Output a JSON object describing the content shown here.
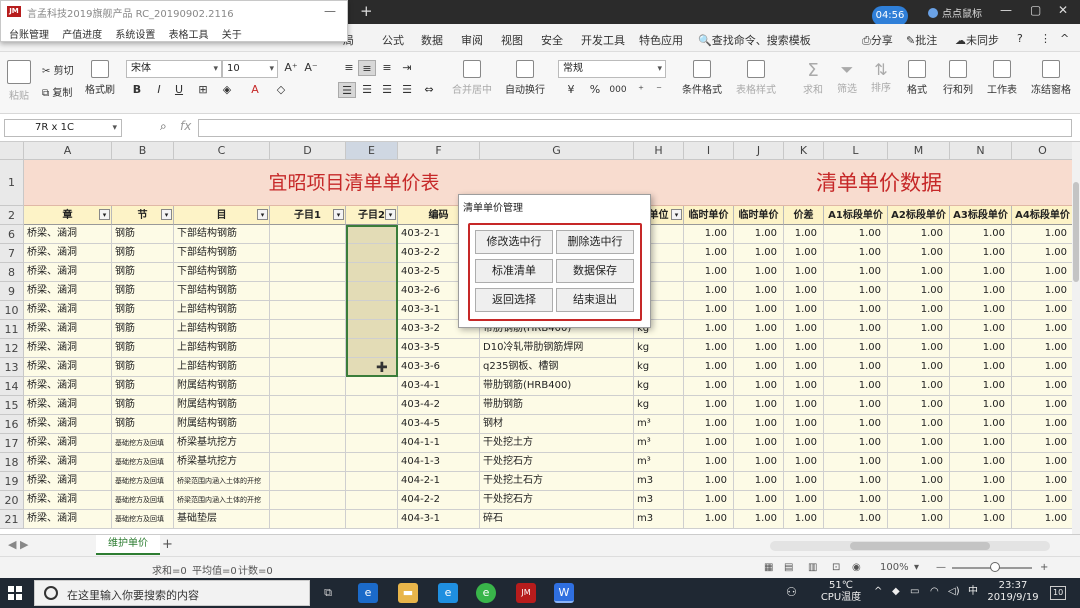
{
  "window": {
    "time_badge": "04:56",
    "mouse_label": "点点鼠标",
    "new_tab": "+",
    "win_min": "—",
    "win_max": "▢",
    "win_close": "✕"
  },
  "popup": {
    "title": "言孟科技2019旗舰产品 RC_20190902.2116",
    "logo": "JM",
    "minimize": "—",
    "menu": [
      "台账管理",
      "产值进度",
      "系统设置",
      "表格工具",
      "关于"
    ]
  },
  "menubar": {
    "items": [
      "局",
      "公式",
      "数据",
      "审阅",
      "视图",
      "安全",
      "开发工具",
      "特色应用"
    ],
    "search": "查找命令、搜索模板",
    "share": "分享",
    "comment": "批注",
    "sync": "未同步",
    "help": "?",
    "more": "⋮",
    "collapse": "^"
  },
  "ribbon": {
    "paste": "粘贴",
    "cut": "剪切",
    "copy": "复制",
    "format_painter": "格式刷",
    "font_name": "宋体",
    "font_size": "10",
    "grow_font": "A⁺",
    "shrink_font": "A⁻",
    "bold": "B",
    "italic": "I",
    "underline": "U",
    "merge": "合并居中",
    "wrap": "自动换行",
    "number_format": "常规",
    "percent": "%",
    "thousands": "000",
    "conditional": "条件格式",
    "table_style": "表格样式",
    "sum": "求和",
    "filter": "筛选",
    "sort": "排序",
    "format": "格式",
    "rowcol": "行和列",
    "sheet": "工作表",
    "freeze": "冻结窗格"
  },
  "formula_bar": {
    "name_box": "7R x 1C",
    "fx": "fx",
    "value": ""
  },
  "sheet": {
    "columns": [
      "A",
      "B",
      "C",
      "D",
      "E",
      "F",
      "G",
      "H",
      "I",
      "J",
      "K",
      "L",
      "M",
      "N",
      "O"
    ],
    "title_left": "宜昭项目清单单价表",
    "title_right": "清单单价数据",
    "headers": [
      "章",
      "节",
      "目",
      "子目1",
      "子目2",
      "编码",
      "",
      "单位",
      "临时单价",
      "临时单价",
      "价差",
      "A1标段单价",
      "A2标段单价",
      "A3标段单价",
      "A4标段单价"
    ],
    "rows": [
      {
        "n": "6",
        "a": "桥梁、涵洞",
        "b": "钢筋",
        "c": "下部结构钢筋",
        "f": "403-2-1",
        "g": "",
        "h": "kg"
      },
      {
        "n": "7",
        "a": "桥梁、涵洞",
        "b": "钢筋",
        "c": "下部结构钢筋",
        "f": "403-2-2",
        "g": "",
        "h": "kg"
      },
      {
        "n": "8",
        "a": "桥梁、涵洞",
        "b": "钢筋",
        "c": "下部结构钢筋",
        "f": "403-2-5",
        "g": "",
        "h": "kg"
      },
      {
        "n": "9",
        "a": "桥梁、涵洞",
        "b": "钢筋",
        "c": "下部结构钢筋",
        "f": "403-2-6",
        "g": "",
        "h": "kg"
      },
      {
        "n": "10",
        "a": "桥梁、涵洞",
        "b": "钢筋",
        "c": "上部结构钢筋",
        "f": "403-3-1",
        "g": "",
        "h": "kg"
      },
      {
        "n": "11",
        "a": "桥梁、涵洞",
        "b": "钢筋",
        "c": "上部结构钢筋",
        "f": "403-3-2",
        "g": "带肋钢筋(HRB400)",
        "h": "kg"
      },
      {
        "n": "12",
        "a": "桥梁、涵洞",
        "b": "钢筋",
        "c": "上部结构钢筋",
        "f": "403-3-5",
        "g": "D10冷轧带肋钢筋焊网",
        "h": "kg"
      },
      {
        "n": "13",
        "a": "桥梁、涵洞",
        "b": "钢筋",
        "c": "上部结构钢筋",
        "f": "403-3-6",
        "g": "q235钢板、槽钢",
        "h": "kg"
      },
      {
        "n": "14",
        "a": "桥梁、涵洞",
        "b": "钢筋",
        "c": "附属结构钢筋",
        "f": "403-4-1",
        "g": "带肋钢筋(HRB400)",
        "h": "kg"
      },
      {
        "n": "15",
        "a": "桥梁、涵洞",
        "b": "钢筋",
        "c": "附属结构钢筋",
        "f": "403-4-2",
        "g": "带肋钢筋",
        "h": "kg"
      },
      {
        "n": "16",
        "a": "桥梁、涵洞",
        "b": "钢筋",
        "c": "附属结构钢筋",
        "f": "403-4-5",
        "g": "钢材",
        "h": "m³"
      },
      {
        "n": "17",
        "a": "桥梁、涵洞",
        "b": "基础挖方及回填",
        "c": "桥梁基坑挖方",
        "f": "404-1-1",
        "g": "干处挖土方",
        "h": "m³"
      },
      {
        "n": "18",
        "a": "桥梁、涵洞",
        "b": "基础挖方及回填",
        "c": "桥梁基坑挖方",
        "f": "404-1-3",
        "g": "干处挖石方",
        "h": "m³"
      },
      {
        "n": "19",
        "a": "桥梁、涵洞",
        "b": "基础挖方及回填",
        "c": "桥梁范围内涵入土体的开挖",
        "f": "404-2-1",
        "g": "干处挖土石方",
        "h": "m3"
      },
      {
        "n": "20",
        "a": "桥梁、涵洞",
        "b": "基础挖方及回填",
        "c": "桥梁范围内涵入土体的开挖",
        "f": "404-2-2",
        "g": "干处挖石方",
        "h": "m3"
      },
      {
        "n": "21",
        "a": "桥梁、涵洞",
        "b": "基础挖方及回填",
        "c": "基础垫层",
        "f": "404-3-1",
        "g": "碎石",
        "h": "m3"
      }
    ],
    "price": "1.00"
  },
  "dialog": {
    "title": "清单单价管理",
    "buttons": [
      "修改选中行",
      "删除选中行",
      "标准清单",
      "数据保存",
      "返回选择",
      "结束退出"
    ]
  },
  "sheet_tabs": {
    "active": "维护单价",
    "add": "+"
  },
  "status": {
    "sum": "求和=0",
    "avg": "平均值=0",
    "count": "计数=0",
    "zoom": "100%",
    "zoom_minus": "—",
    "zoom_plus": "+"
  },
  "taskbar": {
    "search_placeholder": "在这里输入你要搜索的内容",
    "temp": "51℃",
    "cpu": "CPU温度",
    "ime": "中",
    "time": "23:37",
    "date": "2019/9/19",
    "notify": "10"
  }
}
